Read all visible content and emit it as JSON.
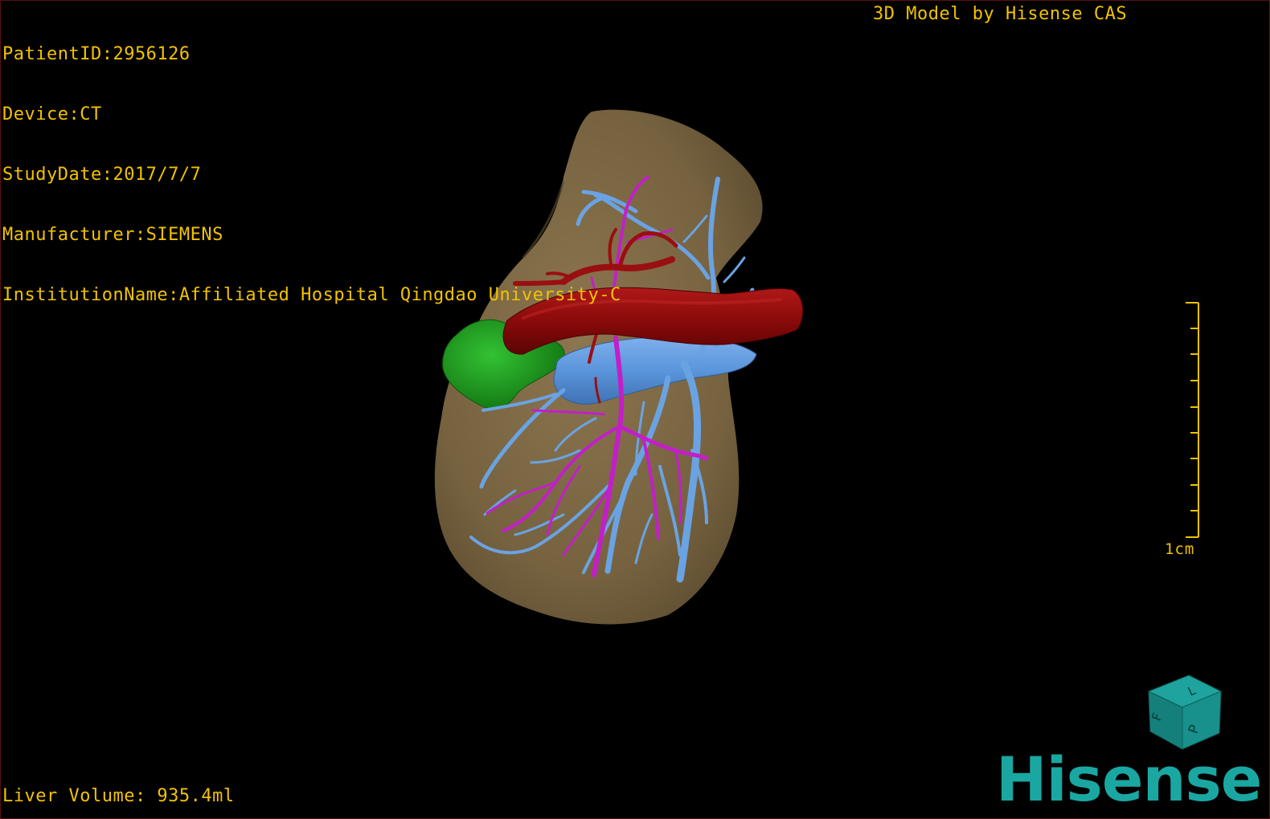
{
  "patient_info": {
    "patient_id": "PatientID:2956126",
    "device": "Device:CT",
    "study_date": "StudyDate:2017/7/7",
    "manufacturer": "Manufacturer:SIEMENS",
    "institution": "InstitutionName:Affiliated Hospital Qingdao University-C"
  },
  "model_credit": "3D Model by Hisense CAS",
  "liver_volume": "Liver Volume: 935.4ml",
  "scale": {
    "label": "1cm"
  },
  "orientation_cube": {
    "faces": [
      "F",
      "L",
      "P"
    ]
  },
  "brand": "Hisense",
  "colors": {
    "overlay_text": "#f2c200",
    "liver": "#7d6845",
    "portal_vein": "#5b95db",
    "artery": "#8b0a0a",
    "hepatic_vein": "#c21fc9",
    "gallbladder": "#1a9b1a",
    "cube": "#168f8a",
    "brand": "#1aa7a2"
  },
  "structures": [
    "liver-surface",
    "portal-vein",
    "hepatic-artery",
    "hepatic-vein",
    "gallbladder"
  ]
}
